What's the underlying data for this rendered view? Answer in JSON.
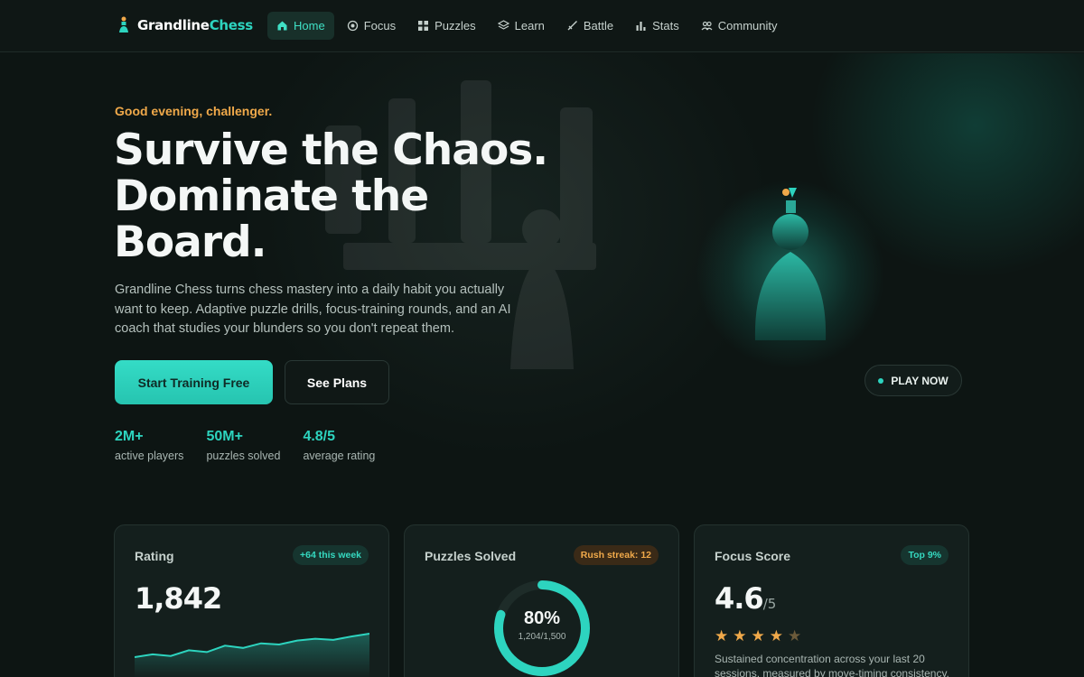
{
  "brand": {
    "name_part1": "Grandline",
    "name_part2": "Chess"
  },
  "nav": {
    "items": [
      {
        "label": "Home",
        "icon": "home-icon",
        "active": true
      },
      {
        "label": "Focus",
        "icon": "target-icon"
      },
      {
        "label": "Puzzles",
        "icon": "grid-icon"
      },
      {
        "label": "Learn",
        "icon": "layers-icon"
      },
      {
        "label": "Battle",
        "icon": "sword-icon"
      },
      {
        "label": "Stats",
        "icon": "bar-chart-icon"
      },
      {
        "label": "Community",
        "icon": "users-icon"
      }
    ]
  },
  "hero": {
    "greeting": "Good evening, challenger.",
    "headline": "Survive the Chaos. Dominate the Board.",
    "subtext": "Grandline Chess turns chess mastery into a daily habit you actually want to keep. Adaptive puzzle drills, focus-training rounds, and an AI coach that studies your blunders so you don't repeat them.",
    "primary_cta": "Start Training Free",
    "secondary_cta": "See Plans",
    "play_now": "PLAY NOW",
    "stats": [
      {
        "value": "2M+",
        "label": "active players"
      },
      {
        "value": "50M+",
        "label": "puzzles solved"
      },
      {
        "value": "4.8/5",
        "label": "average rating"
      }
    ]
  },
  "cards": {
    "rating": {
      "title": "Rating",
      "badge": "+64 this week",
      "value": "1,842",
      "trend": [
        1740,
        1752,
        1745,
        1770,
        1762,
        1790,
        1780,
        1800,
        1795,
        1812,
        1820,
        1815,
        1830,
        1842
      ]
    },
    "puzzles": {
      "title": "Puzzles Solved",
      "badge": "Rush streak: 12",
      "percent_label": "80%",
      "percent": 0.8,
      "detail": "1,204/1,500"
    },
    "focus": {
      "title": "Focus Score",
      "badge": "Top 9%",
      "value": "4.6",
      "suffix": "/5",
      "stars_filled": 4,
      "stars_total": 5,
      "description": "Sustained concentration across your last 20 sessions, measured by move-timing consistency."
    }
  },
  "colors": {
    "accent": "#2dd4bf",
    "warm": "#f0a94a",
    "background": "#0d1513"
  }
}
